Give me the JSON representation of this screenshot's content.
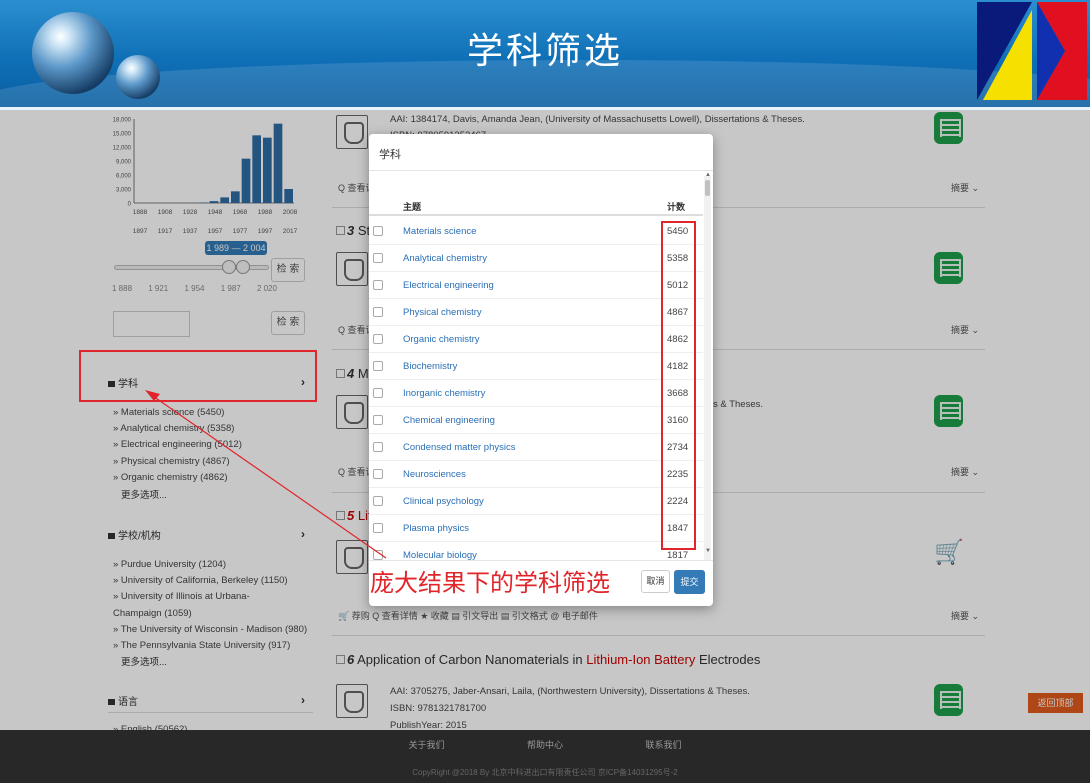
{
  "banner": {
    "title": "学科筛选"
  },
  "histogram": {
    "y_ticks": [
      "18,000",
      "15,000",
      "12,000",
      "9,000",
      "6,000",
      "3,000",
      "0"
    ],
    "x_ticks_top": [
      "1888",
      "1908",
      "1928",
      "1948",
      "1968",
      "1988",
      "2008"
    ],
    "x_ticks_bottom": [
      "1897",
      "1917",
      "1937",
      "1957",
      "1977",
      "1997",
      "2017"
    ],
    "range_label": "1 989 — 2 004",
    "slider_ticks": [
      "1 888",
      "1 921",
      "1 954",
      "1 987",
      "2 020"
    ],
    "search_label": "检 索"
  },
  "chart_data": {
    "type": "bar",
    "title": "",
    "xlabel": "",
    "ylabel": "",
    "ylim": [
      0,
      18000
    ],
    "categories": [
      "1888",
      "1897",
      "1908",
      "1917",
      "1928",
      "1937",
      "1948",
      "1957",
      "1968",
      "1977",
      "1988",
      "1997",
      "2008",
      "2017"
    ],
    "values": [
      0,
      0,
      0,
      0,
      0,
      0,
      100,
      400,
      1200,
      2500,
      9500,
      14500,
      14000,
      17000,
      3000
    ]
  },
  "search_box": {
    "button": "检 索"
  },
  "facets": {
    "subject": {
      "title": "学科",
      "items": [
        "» Materials science  (5450)",
        "» Analytical chemistry  (5358)",
        "» Electrical engineering  (5012)",
        "» Physical chemistry  (4867)",
        "» Organic chemistry  (4862)"
      ],
      "more": "更多选项..."
    },
    "school": {
      "title": "学校/机构",
      "items": [
        "» Purdue University  (1204)",
        "» University of California, Berkeley  (1150)",
        "» University of Illinois at Urbana-",
        "Champaign  (1059)",
        "» The University of Wisconsin - Madison  (980)",
        "» The Pennsylvania State University  (917)"
      ],
      "more": "更多选项..."
    },
    "language": {
      "title": "语言",
      "partial": "» English  (50562)"
    }
  },
  "results": [
    {
      "meta1": "AAI: 1384174, Davis, Amanda Jean, (University of Massachusetts Lowell), Dissertations & Theses.",
      "meta2": "ISBN: 9780591352467",
      "action": "Q 查看详情",
      "abstract": "摘要 ⌄"
    },
    {
      "title_num": "3",
      "title_prefix": "St",
      "abstract": "摘要 ⌄",
      "action": "Q 查看详情"
    },
    {
      "title_num": "4",
      "title_prefix": "M",
      "meta_tail": "s & Theses.",
      "action": "Q 查看详情",
      "abstract": "摘要 ⌄"
    },
    {
      "title_num": "5",
      "title_prefix": "Lit",
      "actions": "🛒 荐购    Q 查看详情    ★ 收藏    ▤ 引文导出    ▤ 引文格式    @ 电子邮件",
      "abstract": "摘要 ⌄"
    },
    {
      "title_num": "6",
      "title_a": "Application of Carbon Nanomaterials in ",
      "title_hl": "Lithium-Ion Battery",
      "title_b": " Electrodes",
      "meta1": "AAI: 3705275, Jaber-Ansari, Laila, (Northwestern University), Dissertations & Theses.",
      "meta2": "ISBN: 9781321781700",
      "meta3": "PublishYear: 2015"
    }
  ],
  "modal": {
    "title": "学科",
    "col_subject": "主题",
    "col_count": "计数",
    "rows": [
      {
        "name": "Materials science",
        "count": "5450"
      },
      {
        "name": "Analytical chemistry",
        "count": "5358"
      },
      {
        "name": "Electrical engineering",
        "count": "5012"
      },
      {
        "name": "Physical chemistry",
        "count": "4867"
      },
      {
        "name": "Organic chemistry",
        "count": "4862"
      },
      {
        "name": "Biochemistry",
        "count": "4182"
      },
      {
        "name": "Inorganic chemistry",
        "count": "3668"
      },
      {
        "name": "Chemical engineering",
        "count": "3160"
      },
      {
        "name": "Condensed matter physics",
        "count": "2734"
      },
      {
        "name": "Neurosciences",
        "count": "2235"
      },
      {
        "name": "Clinical psychology",
        "count": "2224"
      },
      {
        "name": "Plasma physics",
        "count": "1847"
      },
      {
        "name": "Molecular biology",
        "count": "1817"
      }
    ],
    "cancel": "取消",
    "submit": "提交"
  },
  "annotation": "庞大结果下的学科筛选",
  "back_to_top": "返回顶部",
  "footer": {
    "links": [
      "关于我们",
      "帮助中心",
      "联系我们"
    ],
    "copyright": "CopyRight @2018 By 北京中科进出口有限责任公司 京ICP备14031295号-2"
  },
  "colors": {
    "highlight": "#e0262b",
    "link": "#2a6fb5",
    "primary": "#337ab7",
    "banner": "#0f6fb6",
    "green": "#1e9e4a"
  }
}
